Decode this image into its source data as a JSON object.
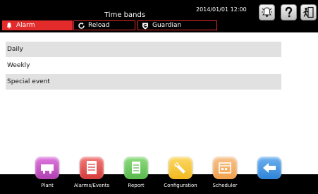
{
  "header": {
    "title": "Time bands",
    "datetime": "2014/01/01  12:00",
    "buttons": [
      {
        "name": "alarm-bell-button",
        "icon": "alarm-bell-icon"
      },
      {
        "name": "help-button",
        "icon": "question-mark-icon"
      },
      {
        "name": "logout-button",
        "icon": "exit-door-icon"
      }
    ]
  },
  "tabs": {
    "alarm": "Alarm",
    "reload": "Reload",
    "guardian": "Guardian"
  },
  "list": {
    "items": [
      {
        "label": "Daily"
      },
      {
        "label": "Weekly"
      },
      {
        "label": "Special event"
      }
    ]
  },
  "nav": {
    "items": [
      {
        "label": "Plant",
        "icon": "plant-icon",
        "color": "#b03fb0"
      },
      {
        "label": "Alarms/Events",
        "icon": "alarms-events-icon",
        "color": "#d63a3a"
      },
      {
        "label": "Report",
        "icon": "report-icon",
        "color": "#57b84a"
      },
      {
        "label": "Configuration",
        "icon": "wrench-icon",
        "color": "#f2b81e"
      },
      {
        "label": "Scheduler",
        "icon": "scheduler-icon",
        "color": "#f0a14a"
      },
      {
        "label": "",
        "icon": "back-arrow-icon",
        "color": "#2d83d8"
      }
    ]
  },
  "colors": {
    "accent_red": "#e32b2b",
    "row_shade": "#e1e1e1",
    "bar_background": "#000000"
  }
}
